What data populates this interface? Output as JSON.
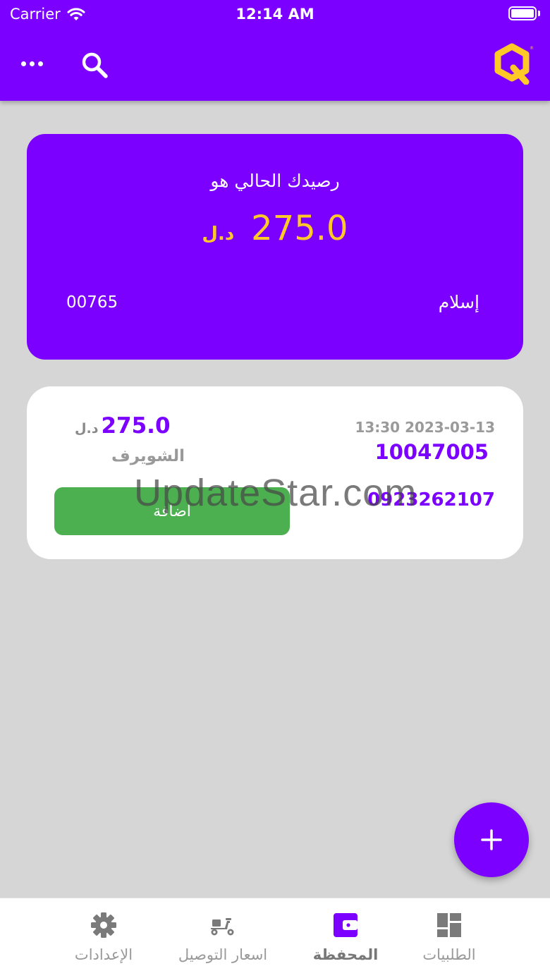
{
  "status_bar": {
    "carrier": "Carrier",
    "time": "12:14 AM"
  },
  "colors": {
    "primary": "#7b00ff",
    "accent": "#ffc928",
    "success": "#4caf50",
    "background": "#d6d6d6"
  },
  "header": {
    "icons": [
      "more-icon",
      "search-icon",
      "app-logo"
    ]
  },
  "balance_card": {
    "title": "رصيدك الحالي هو",
    "amount": "275.0",
    "currency": "د.ل",
    "account_number": "00765",
    "holder_name": "إسلام"
  },
  "transaction": {
    "amount": "275.0",
    "currency": "د.ل",
    "merchant": "الشويرف",
    "datetime": "13:30 2023-03-13",
    "id": "10047005",
    "phone": "0923262107",
    "add_label": "اضافة"
  },
  "watermark": "UpdateStar.com",
  "bottom_nav": {
    "active": "wallet",
    "items": [
      {
        "key": "settings",
        "label": "الإعدادات",
        "icon": "gear-icon"
      },
      {
        "key": "delivery_prices",
        "label": "اسعار التوصيل",
        "icon": "scooter-icon"
      },
      {
        "key": "wallet",
        "label": "المحفظة",
        "icon": "wallet-icon"
      },
      {
        "key": "orders",
        "label": "الطلبيات",
        "icon": "dashboard-icon"
      }
    ]
  }
}
